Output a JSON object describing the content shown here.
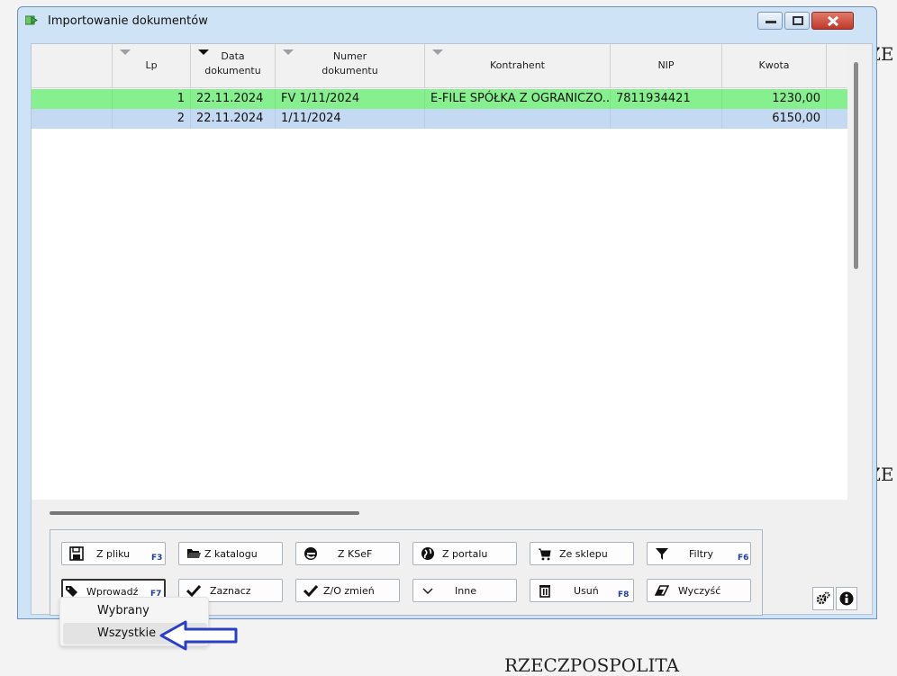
{
  "background": {
    "text_top": "ZE",
    "text_mid": "ZE",
    "text_bottom": "RZECZPOSPOLITA"
  },
  "window": {
    "title": "Importowanie dokumentów",
    "icon": "import-arrow-icon"
  },
  "table": {
    "columns": [
      {
        "key": "lp",
        "label": "Lp"
      },
      {
        "key": "data",
        "label_line1": "Data",
        "label_line2": "dokumentu"
      },
      {
        "key": "numer",
        "label_line1": "Numer",
        "label_line2": "dokumentu"
      },
      {
        "key": "kontrahent",
        "label": "Kontrahent"
      },
      {
        "key": "nip",
        "label": "NIP"
      },
      {
        "key": "kwota",
        "label": "Kwota"
      }
    ],
    "rows": [
      {
        "lp": "1",
        "data": "22.11.2024",
        "numer": "FV 1/11/2024",
        "kontrahent": "E-FILE SPÓŁKA Z OGRANICZO...",
        "nip": "7811934421",
        "kwota": "1230,00",
        "color": "#86f08e"
      },
      {
        "lp": "2",
        "data": "22.11.2024",
        "numer": "1/11/2024",
        "kontrahent": "",
        "nip": "",
        "kwota": "6150,00",
        "color": "#c4d9f2"
      }
    ]
  },
  "buttons": {
    "z_pliku": {
      "label": "Z pliku",
      "key": "F3"
    },
    "z_katalogu": {
      "label": "Z katalogu"
    },
    "z_ksef": {
      "label": "Z KSeF"
    },
    "z_portalu": {
      "label": "Z portalu"
    },
    "ze_sklepu": {
      "label": "Ze sklepu"
    },
    "filtry": {
      "label": "Filtry",
      "key": "F6"
    },
    "wprowadz": {
      "label": "Wprowadź",
      "key": "F7"
    },
    "zaznacz": {
      "label": "Zaznacz"
    },
    "zo_zmien": {
      "label": "Z/O zmień"
    },
    "inne": {
      "label": "Inne"
    },
    "usun": {
      "label": "Usuń",
      "key": "F8"
    },
    "wyczysc": {
      "label": "Wyczyść"
    }
  },
  "dropdown": {
    "items": [
      "Wybrany",
      "Wszystkie"
    ]
  }
}
